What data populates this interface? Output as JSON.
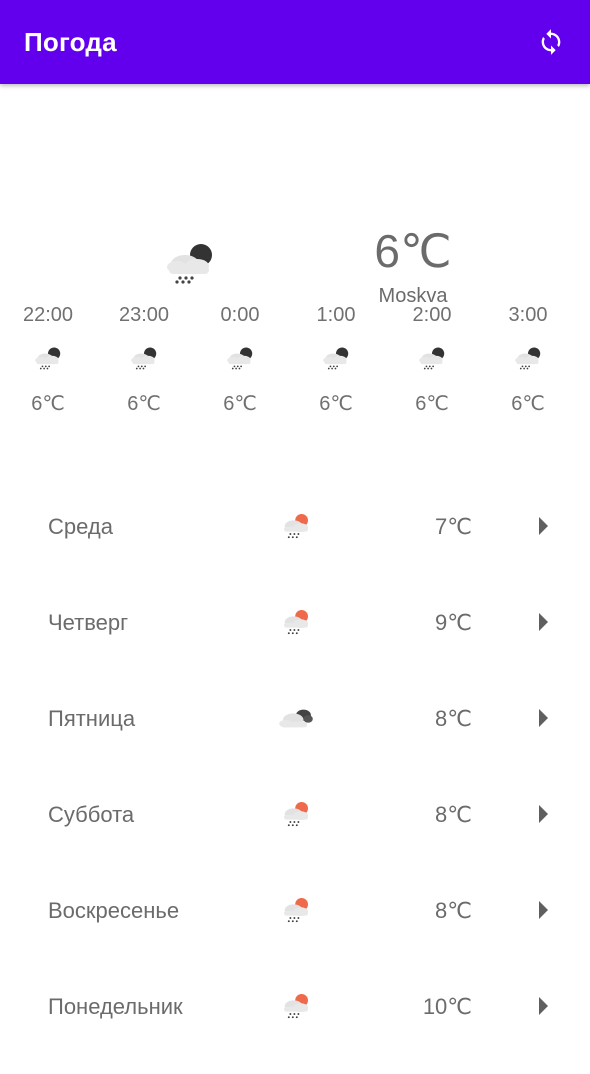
{
  "appbar": {
    "title": "Погода",
    "refresh_icon": "refresh-icon",
    "color": "#6200ee"
  },
  "current": {
    "icon": "night-snow-icon",
    "temp": "6℃",
    "city": "Moskva"
  },
  "hourly": [
    {
      "time": "22:00",
      "icon": "night-snow-icon",
      "temp": "6℃"
    },
    {
      "time": "23:00",
      "icon": "night-snow-icon",
      "temp": "6℃"
    },
    {
      "time": "0:00",
      "icon": "night-snow-icon",
      "temp": "6℃"
    },
    {
      "time": "1:00",
      "icon": "night-snow-icon",
      "temp": "6℃"
    },
    {
      "time": "2:00",
      "icon": "night-snow-icon",
      "temp": "6℃"
    },
    {
      "time": "3:00",
      "icon": "night-snow-icon",
      "temp": "6℃"
    }
  ],
  "daily": [
    {
      "day": "Среда",
      "icon": "day-snow-icon",
      "temp": "7℃"
    },
    {
      "day": "Четверг",
      "icon": "day-snow-icon",
      "temp": "9℃"
    },
    {
      "day": "Пятница",
      "icon": "cloudy-night-icon",
      "temp": "8℃"
    },
    {
      "day": "Суббота",
      "icon": "day-snow-icon",
      "temp": "8℃"
    },
    {
      "day": "Воскресенье",
      "icon": "day-snow-icon",
      "temp": "8℃"
    },
    {
      "day": "Понедельник",
      "icon": "day-snow-icon",
      "temp": "10℃"
    }
  ],
  "colors": {
    "sun": "#ef6a4a",
    "moon": "#333333",
    "cloud": "#e2e2e2",
    "text": "#6b6b6b"
  }
}
